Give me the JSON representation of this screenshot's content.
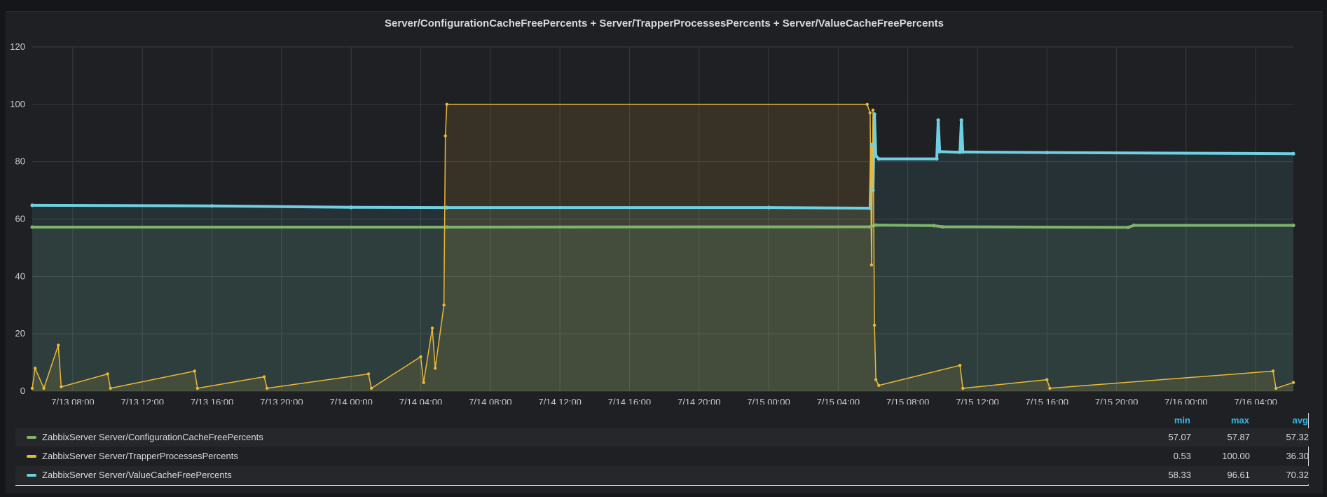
{
  "panel": {
    "title": "Server/ConfigurationCacheFreePercents + Server/TrapperProcessesPercents + Server/ValueCacheFreePercents"
  },
  "legend": {
    "headers": {
      "min": "min",
      "max": "max",
      "avg": "avg"
    },
    "rows": [
      {
        "name": "ZabbixServer Server/ConfigurationCacheFreePercents",
        "color": "#7eb26d",
        "min": "57.07",
        "max": "57.87",
        "avg": "57.32"
      },
      {
        "name": "ZabbixServer Server/TrapperProcessesPercents",
        "color": "#eab839",
        "min": "0.53",
        "max": "100.00",
        "avg": "36.30"
      },
      {
        "name": "ZabbixServer Server/ValueCacheFreePercents",
        "color": "#6ed0e0",
        "min": "58.33",
        "max": "96.61",
        "avg": "70.32"
      }
    ]
  },
  "chart_data": {
    "type": "line",
    "title": "Server/ConfigurationCacheFreePercents + Server/TrapperProcessesPercents + Server/ValueCacheFreePercents",
    "x_range": [
      "7/13 05:40",
      "7/16 06:10"
    ],
    "ylim": [
      0,
      120
    ],
    "y_ticks": [
      0,
      20,
      40,
      60,
      80,
      100,
      120
    ],
    "x_ticks": [
      "7/13 08:00",
      "7/13 12:00",
      "7/13 16:00",
      "7/13 20:00",
      "7/14 00:00",
      "7/14 04:00",
      "7/14 08:00",
      "7/14 12:00",
      "7/14 16:00",
      "7/14 20:00",
      "7/15 00:00",
      "7/15 04:00",
      "7/15 08:00",
      "7/15 12:00",
      "7/15 16:00",
      "7/15 20:00",
      "7/16 00:00",
      "7/16 04:00"
    ],
    "grid": true,
    "legend_position": "bottom",
    "series": [
      {
        "name": "ZabbixServer Server/ConfigurationCacheFreePercents",
        "color": "#7eb26d",
        "points": [
          [
            "7/13 05:40",
            57.2
          ],
          [
            "7/14 05:30",
            57.2
          ],
          [
            "7/15 05:50",
            57.3
          ],
          [
            "7/15 06:10",
            57.9
          ],
          [
            "7/15 09:30",
            57.7
          ],
          [
            "7/15 10:00",
            57.3
          ],
          [
            "7/15 20:40",
            57.1
          ],
          [
            "7/15 21:00",
            57.8
          ],
          [
            "7/16 06:10",
            57.8
          ]
        ]
      },
      {
        "name": "ZabbixServer Server/ValueCacheFreePercents",
        "color": "#6ed0e0",
        "points": [
          [
            "7/13 05:40",
            64.8
          ],
          [
            "7/13 16:00",
            64.6
          ],
          [
            "7/14 00:00",
            64.1
          ],
          [
            "7/14 05:30",
            64.0
          ],
          [
            "7/15 00:00",
            64.0
          ],
          [
            "7/15 05:50",
            63.8
          ],
          [
            "7/15 05:55",
            86.0
          ],
          [
            "7/15 06:00",
            70.0
          ],
          [
            "7/15 06:05",
            96.6
          ],
          [
            "7/15 06:10",
            82.0
          ],
          [
            "7/15 06:20",
            81.0
          ],
          [
            "7/15 09:40",
            81.0
          ],
          [
            "7/15 09:45",
            94.5
          ],
          [
            "7/15 09:50",
            83.5
          ],
          [
            "7/15 11:00",
            83.3
          ],
          [
            "7/15 11:05",
            94.5
          ],
          [
            "7/15 11:10",
            83.4
          ],
          [
            "7/15 16:00",
            83.2
          ],
          [
            "7/16 06:10",
            82.8
          ]
        ]
      },
      {
        "name": "ZabbixServer Server/TrapperProcessesPercents",
        "color": "#eab839",
        "points": [
          [
            "7/13 05:40",
            1.0
          ],
          [
            "7/13 05:50",
            8.0
          ],
          [
            "7/13 06:20",
            1.0
          ],
          [
            "7/13 07:10",
            16.0
          ],
          [
            "7/13 07:20",
            1.5
          ],
          [
            "7/13 10:00",
            6.0
          ],
          [
            "7/13 10:10",
            1.0
          ],
          [
            "7/13 15:00",
            7.0
          ],
          [
            "7/13 15:10",
            1.0
          ],
          [
            "7/13 19:00",
            5.0
          ],
          [
            "7/13 19:10",
            1.0
          ],
          [
            "7/14 01:00",
            6.0
          ],
          [
            "7/14 01:10",
            1.0
          ],
          [
            "7/14 04:00",
            12.0
          ],
          [
            "7/14 04:10",
            3.0
          ],
          [
            "7/14 04:40",
            22.0
          ],
          [
            "7/14 04:50",
            8.0
          ],
          [
            "7/14 05:20",
            30.0
          ],
          [
            "7/14 05:25",
            89.0
          ],
          [
            "7/14 05:30",
            100.0
          ],
          [
            "7/15 05:40",
            100.0
          ],
          [
            "7/15 05:50",
            97.0
          ],
          [
            "7/15 05:55",
            44.0
          ],
          [
            "7/15 06:00",
            98.0
          ],
          [
            "7/15 06:05",
            23.0
          ],
          [
            "7/15 06:10",
            4.0
          ],
          [
            "7/15 06:20",
            2.0
          ],
          [
            "7/15 11:00",
            9.0
          ],
          [
            "7/15 11:10",
            1.0
          ],
          [
            "7/15 16:00",
            4.0
          ],
          [
            "7/15 16:10",
            1.0
          ],
          [
            "7/16 05:00",
            7.0
          ],
          [
            "7/16 05:10",
            1.0
          ],
          [
            "7/16 06:10",
            3.0
          ]
        ]
      }
    ]
  }
}
